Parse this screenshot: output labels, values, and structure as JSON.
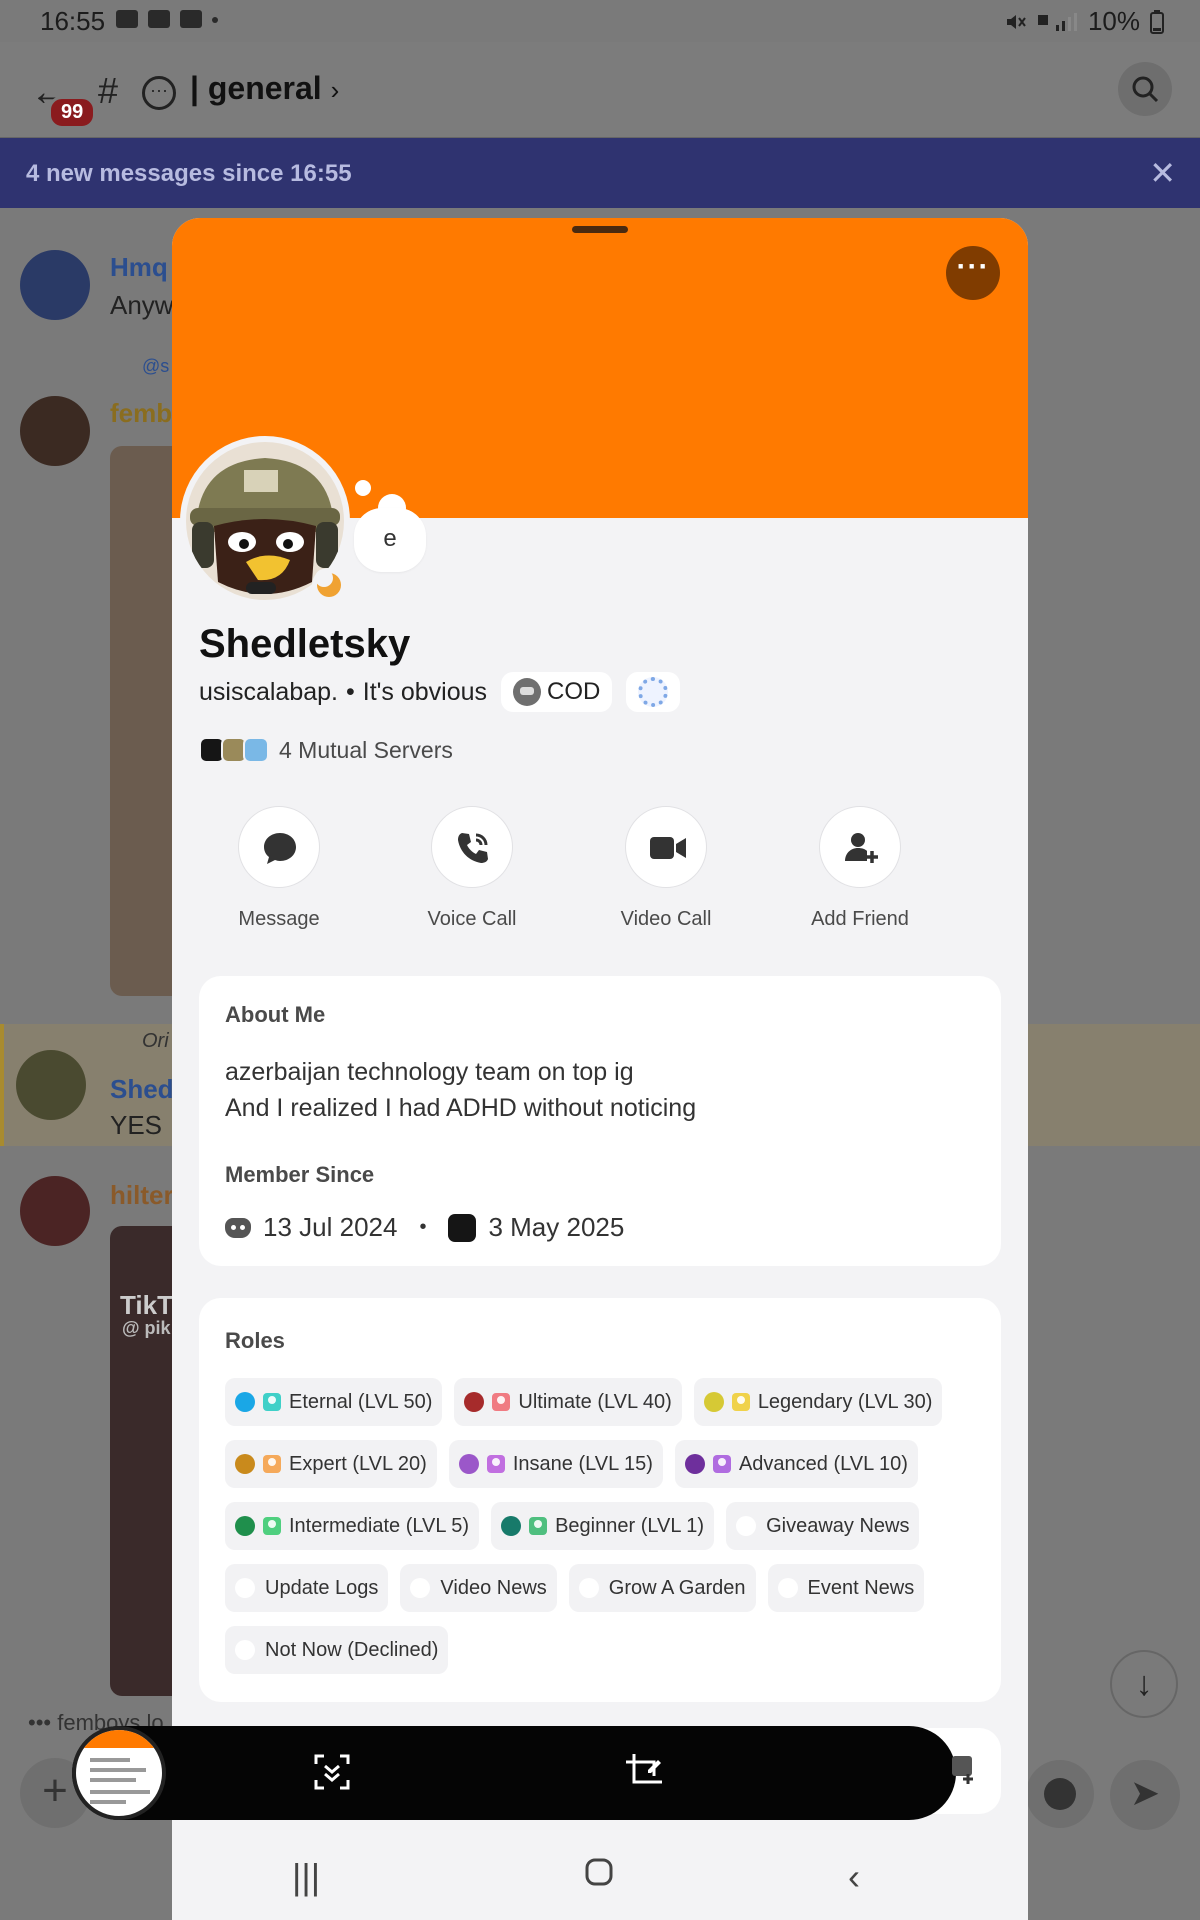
{
  "status_bar": {
    "time": "16:55",
    "battery": "10%"
  },
  "header": {
    "unread_badge": "99",
    "channel": "general",
    "chevron": "›"
  },
  "new_messages_bar": {
    "text": "4 new messages since 16:55",
    "close": "✕"
  },
  "background_chat": {
    "names": [
      "Hmq",
      "femb",
      "Shed",
      "hilter"
    ],
    "texts": [
      "Anyw",
      "YES"
    ],
    "reply_prefix": "@s",
    "orig_prefix": "Ori",
    "tiktok": "TikT",
    "tiktok_handle": "@ pik",
    "typing": "femboys lo"
  },
  "profile": {
    "status_bubble": "e",
    "display_name": "Shedletsky",
    "username": "usiscalabap.",
    "pronoun_sep": "•",
    "custom_tag": "It's obvious",
    "clan_tag": "COD",
    "mutual_servers": "4 Mutual Servers",
    "actions": [
      {
        "label": "Message",
        "icon": "message-icon"
      },
      {
        "label": "Voice Call",
        "icon": "phone-icon"
      },
      {
        "label": "Video Call",
        "icon": "video-icon"
      },
      {
        "label": "Add Friend",
        "icon": "add-friend-icon"
      }
    ],
    "about": {
      "heading": "About Me",
      "line1": "azerbaijan technology team on top ig",
      "line2": "And I realized I had ADHD without noticing",
      "member_since_heading": "Member Since",
      "discord_date": "13 Jul 2024",
      "separator": "•",
      "server_date": "3 May 2025"
    },
    "roles_heading": "Roles",
    "roles": [
      {
        "name": "Eternal (LVL 50)",
        "color": "#1aa7e6",
        "icon_color": "#3fd0c8"
      },
      {
        "name": "Ultimate (LVL 40)",
        "color": "#a62b2b",
        "icon_color": "#f07b82"
      },
      {
        "name": "Legendary (LVL 30)",
        "color": "#d6c935",
        "icon_color": "#f0d24a"
      },
      {
        "name": "Expert (LVL 20)",
        "color": "#c98a1c",
        "icon_color": "#f5a95a"
      },
      {
        "name": "Insane (LVL 15)",
        "color": "#9b57c9",
        "icon_color": "#c16fe0"
      },
      {
        "name": "Advanced (LVL 10)",
        "color": "#6e2f9c",
        "icon_color": "#b06ce0"
      },
      {
        "name": "Intermediate (LVL 5)",
        "color": "#1f8f4c",
        "icon_color": "#4fcf7f"
      },
      {
        "name": "Beginner (LVL 1)",
        "color": "#177a6a",
        "icon_color": "#4fbf7f"
      },
      {
        "name": "Giveaway News",
        "color": ""
      },
      {
        "name": "Update Logs",
        "color": ""
      },
      {
        "name": "Video News",
        "color": ""
      },
      {
        "name": "Grow A Garden",
        "color": ""
      },
      {
        "name": "Event News",
        "color": ""
      },
      {
        "name": "Not Now (Declined)",
        "color": ""
      }
    ]
  },
  "colors": {
    "banner": "#ff7a00",
    "new_msg_bar": "#2f3370"
  }
}
